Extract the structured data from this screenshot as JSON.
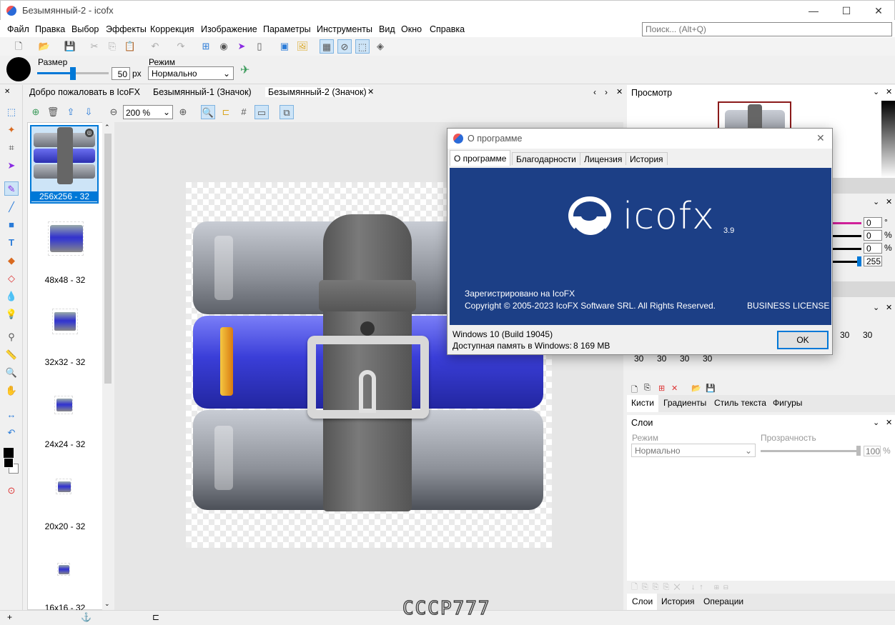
{
  "window": {
    "title": "Безымянный-2 - icofx",
    "minimize": "—",
    "maximize": "☐",
    "close": "✕"
  },
  "menu": [
    "Файл",
    "Правка",
    "Выбор",
    "Эффекты",
    "Коррекция",
    "Изображение",
    "Параметры",
    "Инструменты",
    "Вид",
    "Окно",
    "Справка"
  ],
  "search": {
    "placeholder": "Поиск... (Alt+Q)"
  },
  "options": {
    "size_label": "Размер",
    "size_value": "50",
    "size_unit": "px",
    "mode_label": "Режим",
    "mode_value": "Нормально"
  },
  "doc_tabs": [
    "Добро пожаловать в IcoFX",
    "Безымянный-1 (Значок)",
    "Безымянный-2 (Значок)"
  ],
  "zoom": "200 %",
  "thumbnails": [
    {
      "label": "256x256 - 32"
    },
    {
      "label": "48x48 - 32"
    },
    {
      "label": "32x32 - 32"
    },
    {
      "label": "24x24 - 32"
    },
    {
      "label": "20x20 - 32"
    },
    {
      "label": "16x16 - 32"
    }
  ],
  "right": {
    "preview_title": "Просмотр",
    "adjust_values": [
      "0",
      "0",
      "0",
      "255"
    ],
    "adjust_units": [
      "°",
      "%",
      "%"
    ],
    "brush_sizes_row1": [
      "30",
      "30"
    ],
    "brush_sizes_row2": [
      "30",
      "30",
      "30",
      "30"
    ],
    "brush_tabs": [
      "Кисти",
      "Градиенты",
      "Стиль текста",
      "Фигуры"
    ],
    "layers_title": "Слои",
    "layers_mode_label": "Режим",
    "layers_mode_value": "Нормально",
    "layers_opacity_label": "Прозрачность",
    "layers_opacity_value": "100",
    "layers_opacity_unit": "%",
    "bottom_tabs": [
      "Слои",
      "История",
      "Операции"
    ]
  },
  "dialog": {
    "title": "О программе",
    "tabs": [
      "О программе",
      "Благодарности",
      "Лицензия",
      "История"
    ],
    "logo_text": "icofx",
    "version": "3.9",
    "registered": "Зарегистрировано на IcoFX",
    "copyright": "Copyright © 2005-2023 IcoFX Software SRL. All Rights Reserved.",
    "license": "BUSINESS LICENSE",
    "os": "Windows 10 (Build 19045)",
    "memory_label": "Доступная память в Windows:",
    "memory_value": "8 169 MB",
    "ok": "OK"
  },
  "watermark": "СССР777",
  "colors": {
    "accent": "#0078d7",
    "banner": "#1c3f86",
    "selected_thumb": "#0078d7"
  }
}
